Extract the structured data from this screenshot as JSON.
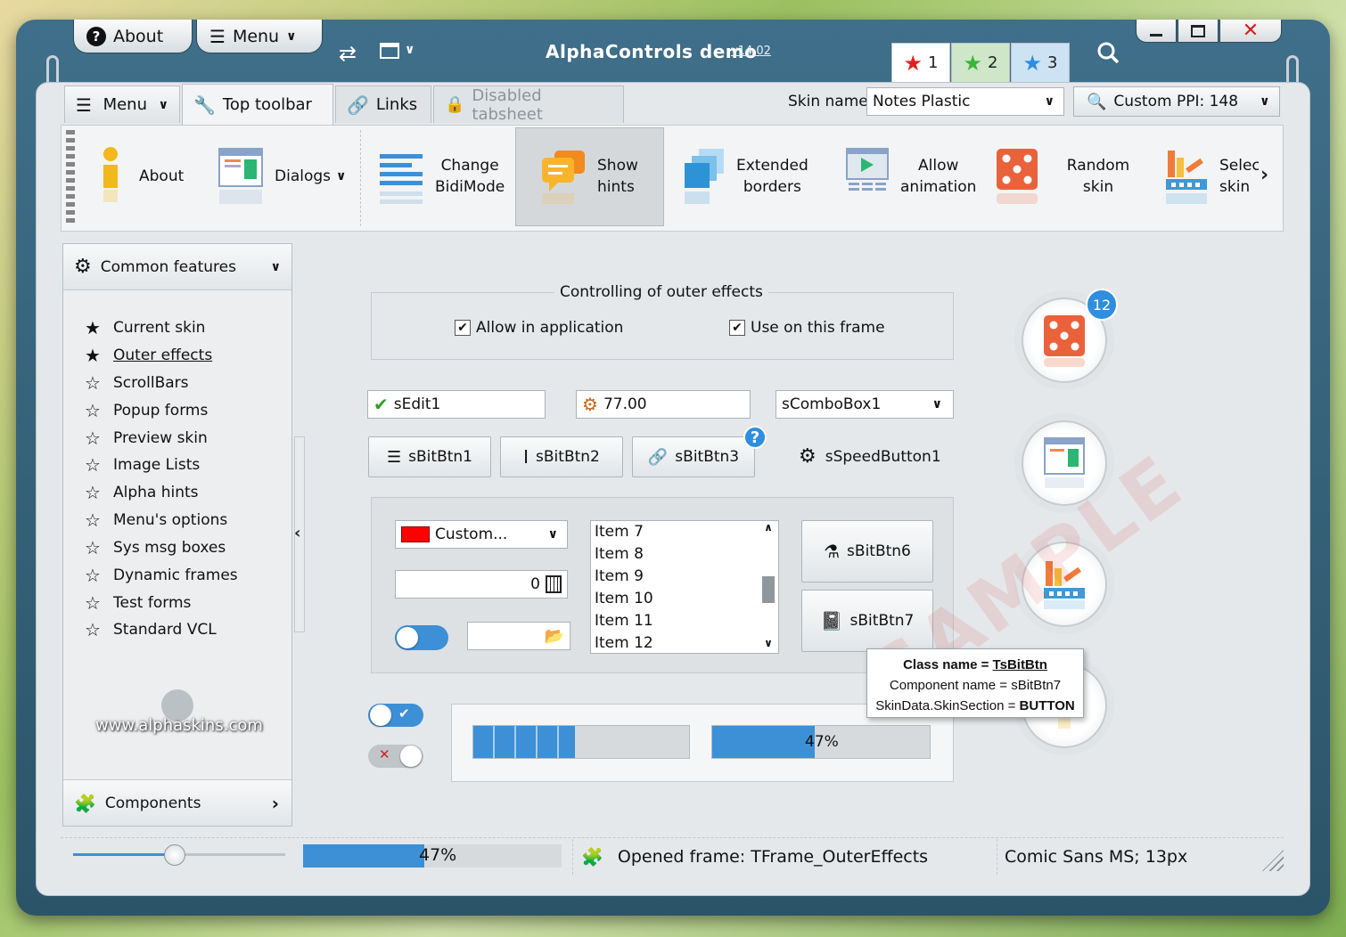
{
  "window": {
    "title": "AlphaControls demo",
    "version": "v14.02",
    "about_label": "About",
    "menu_label": "Menu",
    "star_tabs": [
      {
        "label": "1",
        "color": "#e02020"
      },
      {
        "label": "2",
        "color": "#3ab53a"
      },
      {
        "label": "3",
        "color": "#2d8de0"
      }
    ]
  },
  "tabs": {
    "menu_label": "Menu",
    "items": [
      {
        "label": "Top toolbar"
      },
      {
        "label": "Links"
      },
      {
        "label": "Disabled tabsheet"
      }
    ]
  },
  "skin": {
    "label": "Skin name:",
    "value": "Notes Plastic",
    "ppi_value": "Custom PPI: 148"
  },
  "toolbar": {
    "items": [
      {
        "line1": "About",
        "line2": ""
      },
      {
        "line1": "Dialogs",
        "line2": ""
      },
      {
        "line1": "Change",
        "line2": "BidiMode"
      },
      {
        "line1": "Show",
        "line2": "hints"
      },
      {
        "line1": "Extended",
        "line2": "borders"
      },
      {
        "line1": "Allow",
        "line2": "animation"
      },
      {
        "line1": "Random skin",
        "line2": ""
      },
      {
        "line1": "Selec",
        "line2": "skin"
      }
    ]
  },
  "sidebar": {
    "header": "Common features",
    "items": [
      {
        "label": "Current skin",
        "filled": true
      },
      {
        "label": "Outer effects",
        "filled": true
      },
      {
        "label": "ScrollBars",
        "filled": false
      },
      {
        "label": "Popup forms",
        "filled": false
      },
      {
        "label": "Preview skin",
        "filled": false
      },
      {
        "label": "Image Lists",
        "filled": false
      },
      {
        "label": "Alpha hints",
        "filled": false
      },
      {
        "label": "Menu's options",
        "filled": false
      },
      {
        "label": "Sys msg boxes",
        "filled": false
      },
      {
        "label": "Dynamic frames",
        "filled": false
      },
      {
        "label": "Test forms",
        "filled": false
      },
      {
        "label": "Standard VCL",
        "filled": false
      }
    ],
    "website": "www.alphaskins.com",
    "footer": "Components"
  },
  "frame": {
    "group_title": "Controlling of outer effects",
    "check_app": "Allow in application",
    "check_frame": "Use on this frame",
    "edit1": "sEdit1",
    "number": "77.00",
    "combo": "sComboBox1",
    "btn1": "sBitBtn1",
    "btn2": "sBitBtn2",
    "btn3": "sBitBtn3",
    "speed": "sSpeedButton1",
    "color_combo": "Custom...",
    "calc_value": "0",
    "list_items": [
      "Item 7",
      "Item 8",
      "Item 9",
      "Item 10",
      "Item 11",
      "Item 12"
    ],
    "btn6": "sBitBtn6",
    "btn7": "sBitBtn7",
    "badge": "12",
    "progress_text": "47%",
    "progress_value": 0.47,
    "sample": "SAMPLE"
  },
  "tooltip": {
    "line1_prefix": "Class name = ",
    "line1_value": "TsBitBtn",
    "line2": "Component name = sBitBtn7",
    "line3_prefix": "SkinData.SkinSection = ",
    "line3_value": "BUTTON"
  },
  "status": {
    "progress_text": "47%",
    "frame": "Opened frame: TFrame_OuterEffects",
    "font": "Comic Sans MS; 13px"
  }
}
